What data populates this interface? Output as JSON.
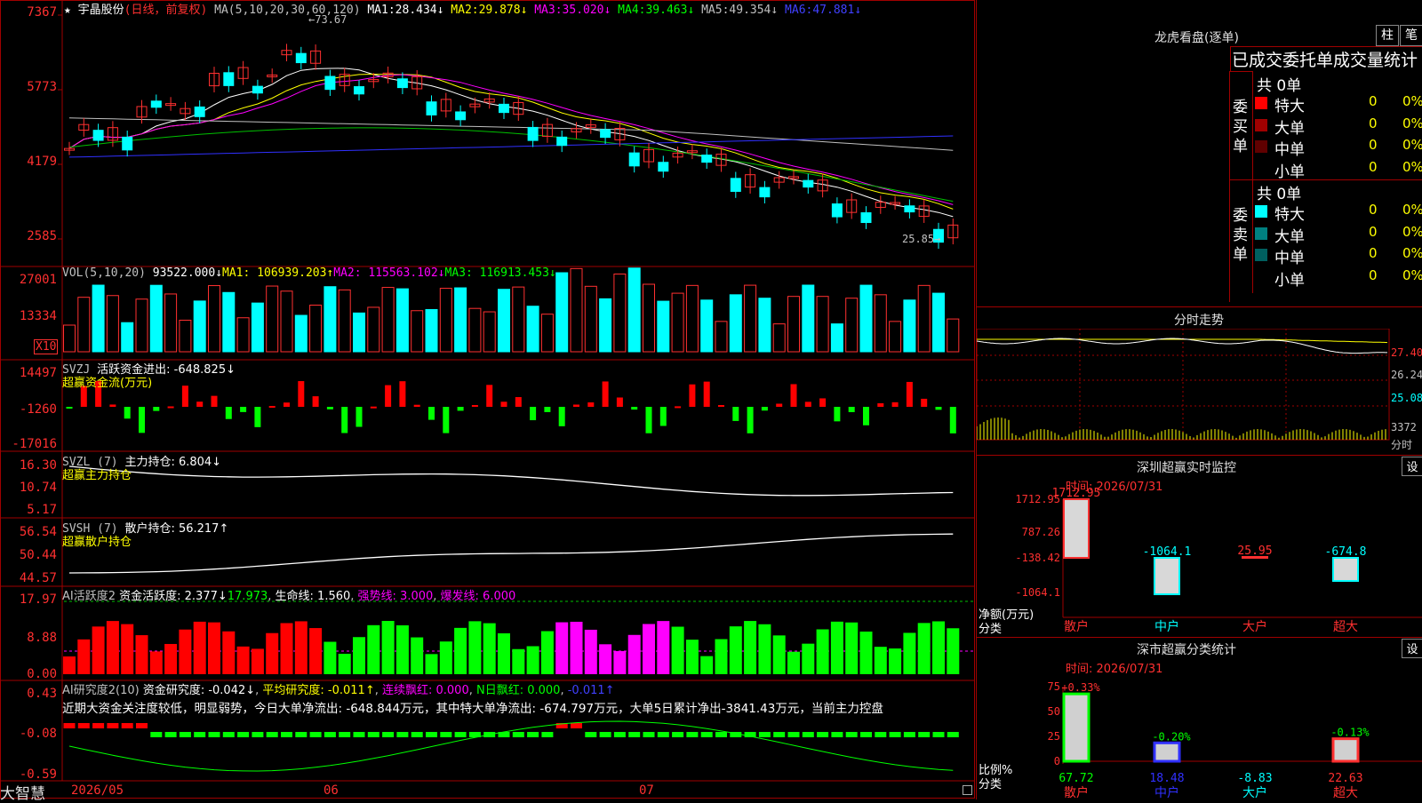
{
  "colors": {
    "up": "#ff3030",
    "down": "#00ffff",
    "bg": "#000000",
    "frame": "#a00000",
    "ma1": "#ffffff",
    "ma2": "#ffff00",
    "ma3": "#ff00ff",
    "ma4": "#00c000",
    "ma5": "#c0c0c0",
    "ma6": "#3030ff"
  },
  "stock": {
    "star_icon": "star-icon",
    "name": "宇晶股份",
    "mode": "(日线，前复权)"
  },
  "main_panel": {
    "ma_label": "MA(5,10,20,30,60,120)",
    "ma": [
      {
        "label": "MA1:",
        "value": "28.434↓"
      },
      {
        "label": "MA2:",
        "value": "29.878↓"
      },
      {
        "label": "MA3:",
        "value": "35.020↓"
      },
      {
        "label": "MA4:",
        "value": "39.463↓"
      },
      {
        "label": "MA5:",
        "value": "49.354↓"
      },
      {
        "label": "MA6:",
        "value": "47.881↓"
      }
    ],
    "y_ticks": [
      "7367",
      "5773",
      "4179",
      "2585"
    ],
    "high_label": "←73.67",
    "low_label": "25.85→"
  },
  "vol_panel": {
    "label": "VOL(5,10,20)",
    "value": "93522.000↓",
    "ma1": "MA1: 106939.203↑",
    "ma2": "MA2: 115563.102↓",
    "ma3": "MA3: 116913.453↓",
    "y_ticks": [
      "27001",
      "13334"
    ],
    "unit": "X10"
  },
  "svzj_panel": {
    "label": "SVZJ",
    "desc": "活跃资金进出: -648.825↓",
    "sub": "超赢资金流(万元)",
    "y_ticks": [
      "14497",
      "-1260",
      "-17016"
    ]
  },
  "svzl_panel": {
    "label": "SVZL (7)",
    "desc": "主力持仓: 6.804↓",
    "sub": "超赢主力持仓",
    "y_ticks": [
      "16.30",
      "10.74",
      "5.17"
    ]
  },
  "svsh_panel": {
    "label": "SVSH (7)",
    "desc": "散户持仓: 56.217↑",
    "sub": "超赢散户持仓",
    "y_ticks": [
      "56.54",
      "50.44",
      "44.57"
    ]
  },
  "ai_active_panel": {
    "label": "AI活跃度2",
    "desc": "资金活跃度: 2.377↓",
    "v2": "17.973",
    "v3": "生命线: 1.560",
    "v4": "强势线: 3.000",
    "v5": "爆发线: 6.000",
    "y_ticks": [
      "17.97",
      "8.88",
      "0.00"
    ]
  },
  "ai_research_panel": {
    "label": "AI研究度2(10)",
    "desc": "资金研究度: -0.042↓",
    "v2": "平均研究度: -0.011↑",
    "v3": "连续飘红: 0.000",
    "v4": "N日飘红: 0.000",
    "v5": "-0.011↑",
    "comment": "近期大资金关注度较低，明显弱势，今日大单净流出: -648.844万元，其中特大单净流出: -674.797万元，大单5日累计净出-3841.43万元，当前主力控盘",
    "y_ticks": [
      "0.43",
      "-0.08",
      "-0.59"
    ]
  },
  "bottom_bar": {
    "brand": "大智慧",
    "date1": "2026/05",
    "date2": "06",
    "date3": "07"
  },
  "longhu": {
    "title": "龙虎看盘(逐单)",
    "btn1": "柱",
    "btn2": "笔",
    "subtitle": "已成交委托单成交量统计",
    "buy_side": {
      "label": "委买单",
      "total": "共 0单",
      "rows": [
        {
          "name": "特大",
          "color": "#ff0000",
          "vol": "0",
          "pct": "0%"
        },
        {
          "name": "大单",
          "color": "#a00000",
          "vol": "0",
          "pct": "0%"
        },
        {
          "name": "中单",
          "color": "#600000",
          "vol": "0",
          "pct": "0%"
        },
        {
          "name": "小单",
          "color": "",
          "vol": "0",
          "pct": "0%"
        }
      ]
    },
    "sell_side": {
      "label": "委卖单",
      "total": "共 0单",
      "rows": [
        {
          "name": "特大",
          "color": "#00ffff",
          "vol": "0",
          "pct": "0%"
        },
        {
          "name": "大单",
          "color": "#008080",
          "vol": "0",
          "pct": "0%"
        },
        {
          "name": "中单",
          "color": "#006060",
          "vol": "0",
          "pct": "0%"
        },
        {
          "name": "小单",
          "color": "",
          "vol": "0",
          "pct": "0%"
        }
      ]
    }
  },
  "intraday": {
    "title": "分时走势",
    "y_ticks": [
      "27.40",
      "26.24",
      "25.08"
    ],
    "vol_tick": "3372",
    "vol_label": "分时"
  },
  "sz_monitor": {
    "title": "深圳超赢实时监控",
    "settings": "设",
    "time": "时间: 2026/07/31",
    "y_ticks": [
      "1712.95",
      "787.26",
      "-138.42",
      "-1064.1"
    ],
    "axis_label": "净额(万元)",
    "axis_sub": "分类",
    "categories": [
      "散户",
      "中户",
      "大户",
      "超大"
    ],
    "values": [
      1712.95,
      -1064.1,
      25.95,
      -674.8
    ],
    "value_labels": [
      "1712.95",
      "-1064.1",
      "25.95",
      "-674.8"
    ]
  },
  "sz_classify": {
    "title": "深市超赢分类统计",
    "settings": "设",
    "time": "时间: 2026/07/31",
    "y_ticks": [
      "75",
      "50",
      "25",
      "0"
    ],
    "axis_label": "比例%",
    "axis_sub": "分类",
    "categories": [
      "散户",
      "中户",
      "大户",
      "超大"
    ],
    "top_labels": [
      "+0.33%",
      "-0.20%",
      "",
      "-0.13%"
    ],
    "values": [
      67.72,
      18.48,
      -8.83,
      22.63
    ],
    "value_labels": [
      "67.72",
      "18.48",
      "-8.83",
      "22.63"
    ]
  }
}
